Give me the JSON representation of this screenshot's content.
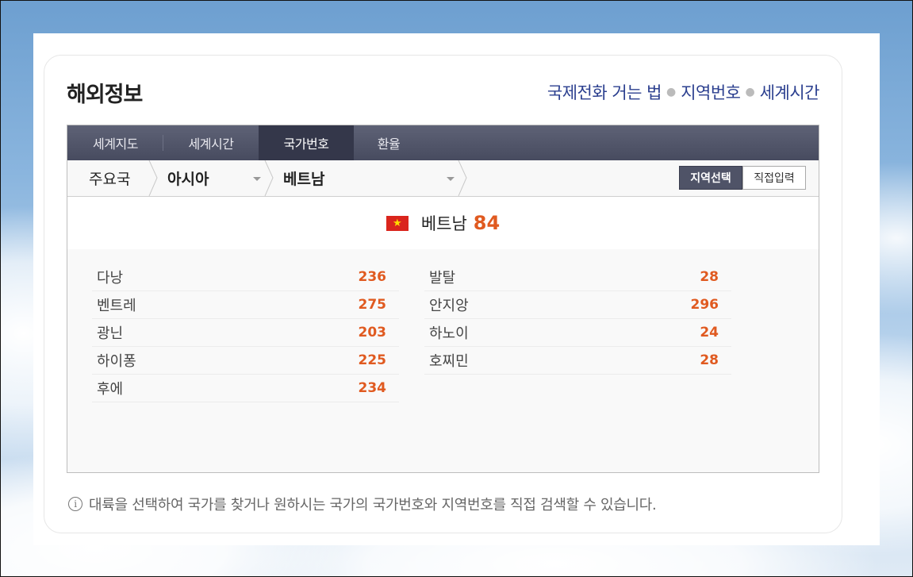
{
  "title": "해외정보",
  "top_links": [
    "국제전화 거는 법",
    "지역번호",
    "세계시간"
  ],
  "tabs": [
    "세계지도",
    "세계시간",
    "국가번호",
    "환율"
  ],
  "active_tab": "국가번호",
  "breadcrumb": {
    "level1": "주요국",
    "level2": "아시아",
    "level3": "베트남"
  },
  "mode_buttons": {
    "select": "지역선택",
    "direct": "직접입력"
  },
  "country": {
    "name": "베트남",
    "code": "84",
    "flag_icon": "vietnam-flag-icon",
    "flag_colors": {
      "bg": "#da251d",
      "star": "#ffde00"
    }
  },
  "regions_left": [
    {
      "name": "다낭",
      "code": "236"
    },
    {
      "name": "벤트레",
      "code": "275"
    },
    {
      "name": "광닌",
      "code": "203"
    },
    {
      "name": "하이퐁",
      "code": "225"
    },
    {
      "name": "후에",
      "code": "234"
    }
  ],
  "regions_right": [
    {
      "name": "발탈",
      "code": "28"
    },
    {
      "name": "안지앙",
      "code": "296"
    },
    {
      "name": "하노이",
      "code": "24"
    },
    {
      "name": "호찌민",
      "code": "28"
    }
  ],
  "note": "대륙을 선택하여 국가를 찾거나 원하시는 국가의 국가번호와 지역번호를 직접 검색할 수 있습니다.",
  "colors": {
    "accent_orange": "#e05a20",
    "link_blue": "#2b3f8f",
    "tab_bar": "#474b5f",
    "tab_active": "#34374a"
  }
}
